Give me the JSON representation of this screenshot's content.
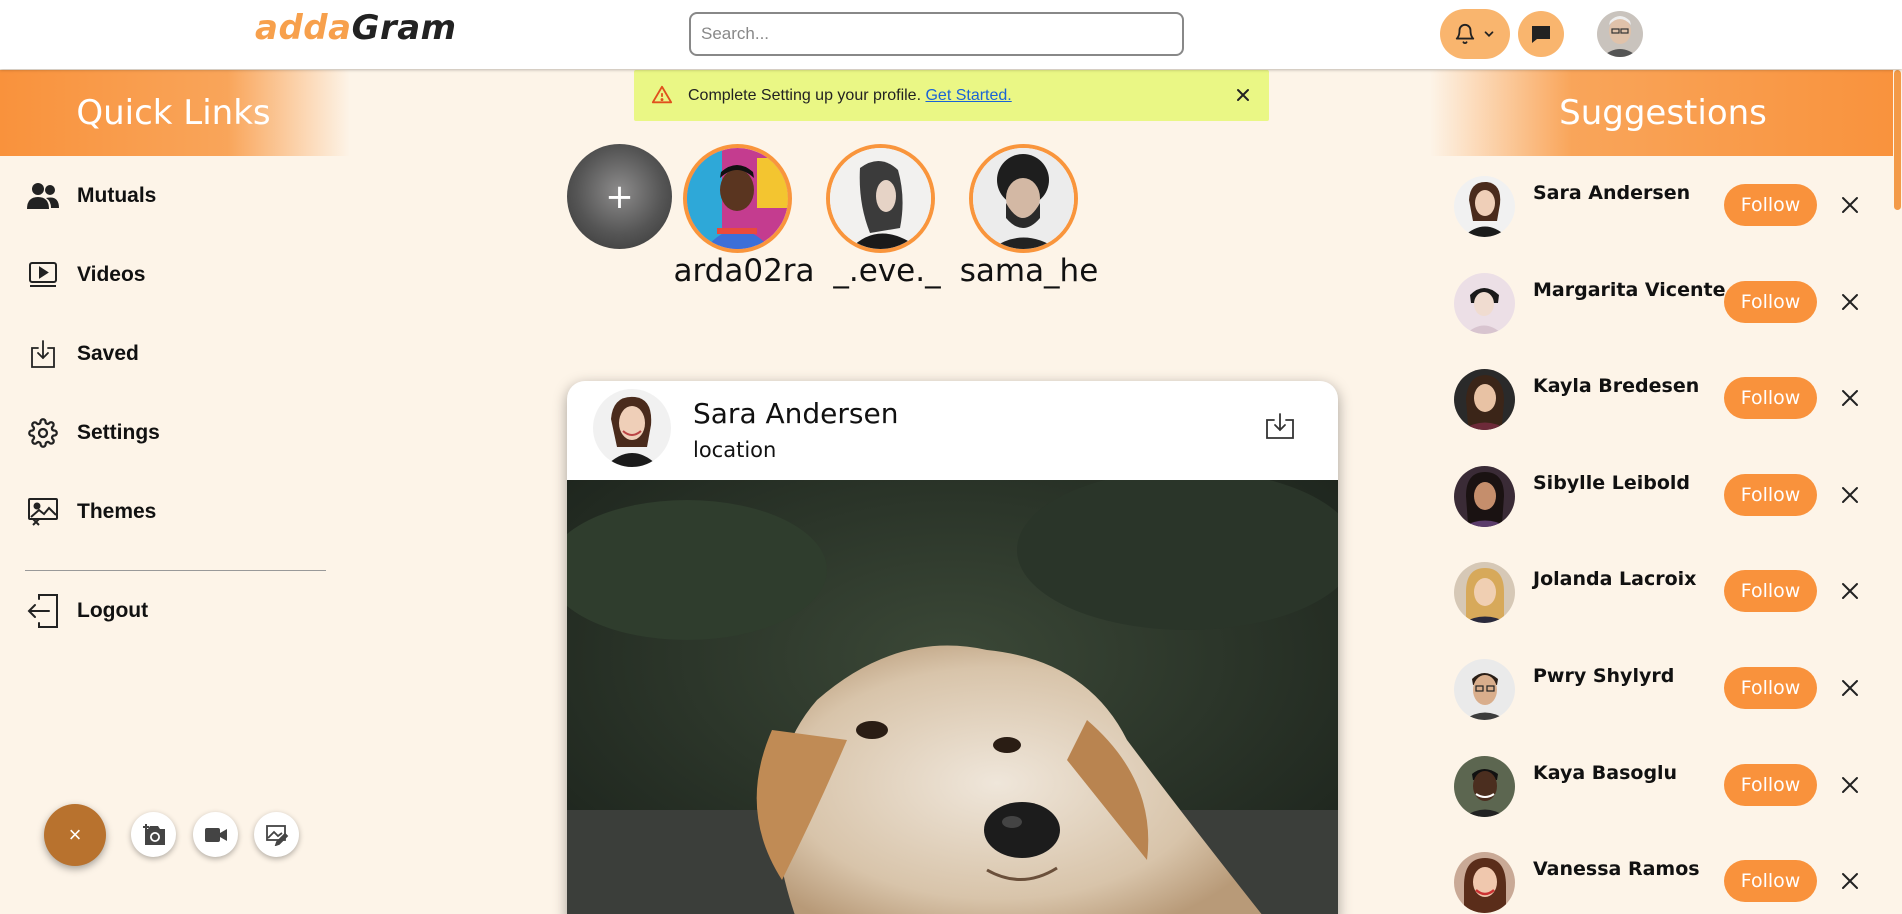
{
  "app": {
    "logo_part1": "adda",
    "logo_part2": "Gram",
    "accent_color": "#f9923c"
  },
  "topbar": {
    "search_placeholder": "Search...",
    "icons": [
      "bell-icon",
      "chevron-down-icon",
      "chat-icon",
      "user-avatar"
    ]
  },
  "notice": {
    "message": "Complete Setting up your profile.",
    "link_text": "Get Started.",
    "icon": "warning-icon"
  },
  "sidebar": {
    "title": "Quick Links",
    "items": [
      {
        "label": "Mutuals",
        "icon": "users-icon"
      },
      {
        "label": "Videos",
        "icon": "video-play-icon"
      },
      {
        "label": "Saved",
        "icon": "download-tray-icon"
      },
      {
        "label": "Settings",
        "icon": "gear-icon"
      },
      {
        "label": "Themes",
        "icon": "image-monitor-icon"
      },
      {
        "label": "Logout",
        "icon": "logout-icon"
      }
    ]
  },
  "fab": {
    "main_glyph": "×",
    "actions": [
      "camera-plus-icon",
      "video-camera-icon",
      "image-edit-icon"
    ]
  },
  "stories": {
    "add_glyph": "+",
    "items": [
      {
        "name": "arda02ra"
      },
      {
        "name": "_.eve._"
      },
      {
        "name": "sama_he"
      }
    ]
  },
  "post": {
    "author": "Sara Andersen",
    "location": "location",
    "image": "dog-photo"
  },
  "suggestions": {
    "title": "Suggestions",
    "follow_label": "Follow",
    "people": [
      {
        "name": "Sara Andersen"
      },
      {
        "name": "Margarita Vicente"
      },
      {
        "name": "Kayla Bredesen"
      },
      {
        "name": "Sibylle Leibold"
      },
      {
        "name": "Jolanda Lacroix"
      },
      {
        "name": "Pwry Shylyrd"
      },
      {
        "name": "Kaya Basoglu"
      },
      {
        "name": "Vanessa Ramos"
      }
    ]
  }
}
